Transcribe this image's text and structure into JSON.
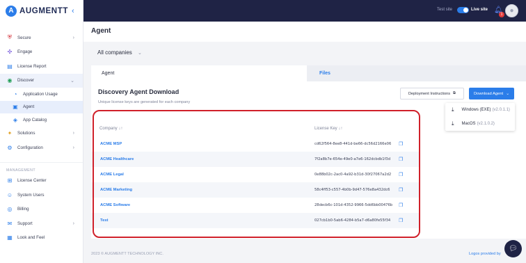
{
  "brand": {
    "name": "AUGMENTT",
    "mark": "A",
    "collapse": "‹"
  },
  "topbar": {
    "test_site": "Test site",
    "live_site": "Live site",
    "notif_count": "1"
  },
  "sidebar": {
    "items": [
      {
        "label": "Secure",
        "icon": "shield-icon"
      },
      {
        "label": "Engage",
        "icon": "engage-icon"
      },
      {
        "label": "License Report",
        "icon": "report-icon"
      },
      {
        "label": "Discover",
        "icon": "discover-icon"
      },
      {
        "label": "Application Usage",
        "icon": "pie-icon"
      },
      {
        "label": "Agent",
        "icon": "agent-icon"
      },
      {
        "label": "App Catalog",
        "icon": "catalog-icon"
      },
      {
        "label": "Solutions",
        "icon": "solutions-icon"
      },
      {
        "label": "Configuration",
        "icon": "gear-icon"
      }
    ],
    "section": "MANAGEMENT",
    "mgmt": [
      {
        "label": "License Center",
        "icon": "license-icon"
      },
      {
        "label": "System Users",
        "icon": "users-icon"
      },
      {
        "label": "Billing",
        "icon": "billing-icon"
      },
      {
        "label": "Support",
        "icon": "support-icon"
      },
      {
        "label": "Look and Feel",
        "icon": "look-icon"
      }
    ]
  },
  "page": {
    "title": "Agent",
    "company_select": "All companies"
  },
  "tabs": [
    {
      "label": "Agent"
    },
    {
      "label": "Files"
    }
  ],
  "card": {
    "title": "Discovery Agent Download",
    "subtitle": "Unique license keys are generated for each company",
    "instructions_label": "Deployment Instructions",
    "download_label": "Download Agent"
  },
  "dropdown": [
    {
      "label": "Windows (EXE)",
      "version": "(v2.0.1.1)"
    },
    {
      "label": "MacOS",
      "version": "(v2.1.0.2)"
    }
  ],
  "table": {
    "col_company": "Company",
    "col_key": "License Key",
    "rows": [
      {
        "company": "ACME MSP",
        "key": "cd62f564-8ee8-441d-be66-dc56d2166e06"
      },
      {
        "company": "ACME Healthcare",
        "key": "7f2a8b7e-654e-49e0-a7e6-162dcbdb1f3d"
      },
      {
        "company": "ACME Legal",
        "key": "0e88b02c-2ac0-4a92-b31d-30f27067a2d2"
      },
      {
        "company": "ACME Marketing",
        "key": "58c4ff53-c557-4b0b-9d47-576e8a432dc6"
      },
      {
        "company": "ACME Software",
        "key": "28decb6c-101d-4352-9966-5dd6bb00476b"
      },
      {
        "company": "Test",
        "key": "027cb1b0-5ab6-4284-b5a7-d6a80fe55f34"
      }
    ]
  },
  "footer": {
    "copyright": "2023 © AUGMENTT TECHNOLOGY INC.",
    "right": "Logos provided by"
  },
  "colors": {
    "accent": "#2b7de9",
    "topbar": "#1f2345",
    "highlight": "#d0202a"
  }
}
